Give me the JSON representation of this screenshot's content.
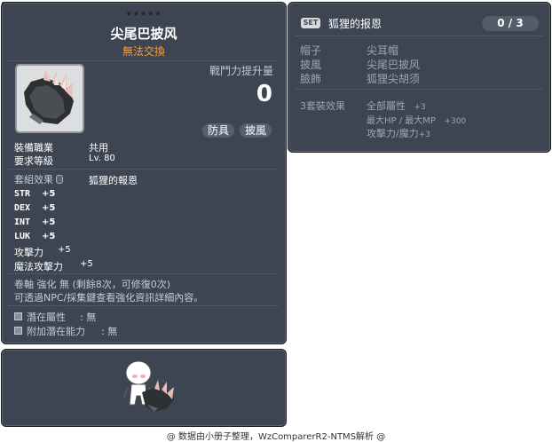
{
  "item_id": "01102660",
  "item": {
    "stars": "★★★★★",
    "name": "尖尾巴披风",
    "trade": "無法交換",
    "combat_power_label": "戰鬥力提升量",
    "combat_power_value": "0",
    "tags": [
      "防具",
      "披風"
    ],
    "job_label": "裝備職業",
    "job_value": "共用",
    "level_label": "要求等級",
    "level_value": "Lv. 80",
    "set_effect_label": "套組效果",
    "set_effect_value": "狐狸的報恩",
    "stats": [
      {
        "name": "STR",
        "value": "+5"
      },
      {
        "name": "DEX",
        "value": "+5"
      },
      {
        "name": "INT",
        "value": "+5"
      },
      {
        "name": "LUK",
        "value": "+5"
      }
    ],
    "attack": {
      "name": "攻擊力",
      "value": "+5"
    },
    "magic_attack": {
      "name": "魔法攻擊力",
      "value": "+5"
    },
    "scroll_line": "卷軸 強化 無 (剩餘8次，可修復0次)",
    "info_line": "可透過NPC/採集鍵查看強化資訊詳細內容。",
    "potential_label": "潛在屬性",
    "potential_value": ": 無",
    "additional_label": "附加潛在能力",
    "additional_value": ": 無"
  },
  "set": {
    "badge": "SET",
    "name": "狐狸的报恩",
    "count": "0 / 3",
    "parts": [
      {
        "slot": "帽子",
        "name": "尖耳帽"
      },
      {
        "slot": "披風",
        "name": "尖尾巴披风"
      },
      {
        "slot": "臉飾",
        "name": "狐狸尖胡须"
      }
    ],
    "bonus_label": "3套裝效果",
    "bonuses": [
      {
        "name": "全部屬性",
        "value": "+3"
      },
      {
        "name": "最大HP / 最大MP",
        "value": "+300"
      },
      {
        "name": "攻擊力/魔力",
        "value": "+3"
      }
    ]
  },
  "footer": "@ 数据由小册子整理，WzComparerR2-NTMS解析 @",
  "colors": {
    "panel_bg": "#3e4552",
    "trade": "#ff9b2e",
    "muted": "#9ea5af"
  }
}
